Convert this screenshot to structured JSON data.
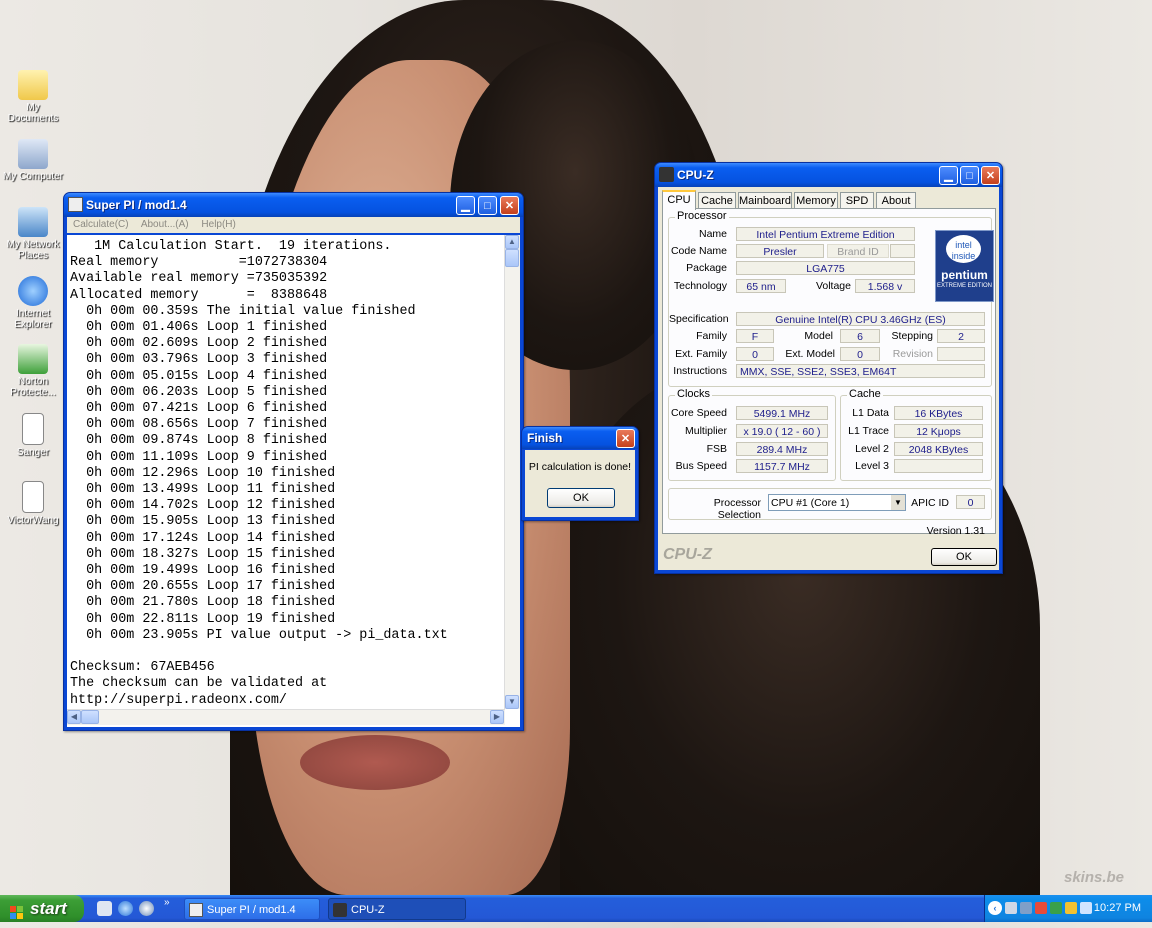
{
  "desktop": {
    "icons": [
      {
        "label": "My Documents",
        "icon": "folder-icon"
      },
      {
        "label": "My Computer",
        "icon": "computer-icon"
      },
      {
        "label": "My Network Places",
        "icon": "network-icon"
      },
      {
        "label": "Internet Explorer",
        "icon": "ie-icon"
      },
      {
        "label": "Norton Protecte...",
        "icon": "norton-icon"
      },
      {
        "label": "Sanger",
        "icon": "text-file-icon"
      },
      {
        "label": "VictorWang",
        "icon": "text-file-icon"
      }
    ],
    "watermark": "skins.be"
  },
  "superpi": {
    "title": "Super PI / mod1.4",
    "menu": [
      "Calculate(C)",
      "About...(A)",
      "Help(H)"
    ],
    "output": "   1M Calculation Start.  19 iterations.\nReal memory          =1072738304\nAvailable real memory =735035392\nAllocated memory      =  8388648\n  0h 00m 00.359s The initial value finished\n  0h 00m 01.406s Loop 1 finished\n  0h 00m 02.609s Loop 2 finished\n  0h 00m 03.796s Loop 3 finished\n  0h 00m 05.015s Loop 4 finished\n  0h 00m 06.203s Loop 5 finished\n  0h 00m 07.421s Loop 6 finished\n  0h 00m 08.656s Loop 7 finished\n  0h 00m 09.874s Loop 8 finished\n  0h 00m 11.109s Loop 9 finished\n  0h 00m 12.296s Loop 10 finished\n  0h 00m 13.499s Loop 11 finished\n  0h 00m 14.702s Loop 12 finished\n  0h 00m 15.905s Loop 13 finished\n  0h 00m 17.124s Loop 14 finished\n  0h 00m 18.327s Loop 15 finished\n  0h 00m 19.499s Loop 16 finished\n  0h 00m 20.655s Loop 17 finished\n  0h 00m 21.780s Loop 18 finished\n  0h 00m 22.811s Loop 19 finished\n  0h 00m 23.905s PI value output -> pi_data.txt\n\nChecksum: 67AEB456\nThe checksum can be validated at\nhttp://superpi.radeonx.com/"
  },
  "finish_dialog": {
    "title": "Finish",
    "message": "PI calculation is done!",
    "ok": "OK"
  },
  "cpuz": {
    "title": "CPU-Z",
    "tabs": [
      "CPU",
      "Cache",
      "Mainboard",
      "Memory",
      "SPD",
      "About"
    ],
    "active_tab": "CPU",
    "processor": {
      "group": "Processor",
      "name_label": "Name",
      "name": "Intel Pentium Extreme Edition",
      "codename_label": "Code Name",
      "codename": "Presler",
      "brandid_label": "Brand ID",
      "brandid": "",
      "package_label": "Package",
      "package": "LGA775",
      "technology_label": "Technology",
      "technology": "65 nm",
      "voltage_label": "Voltage",
      "voltage": "1.568 v",
      "spec_label": "Specification",
      "spec": "Genuine Intel(R) CPU 3.46GHz (ES)",
      "family_label": "Family",
      "family": "F",
      "model_label": "Model",
      "model": "6",
      "stepping_label": "Stepping",
      "stepping": "2",
      "extfamily_label": "Ext. Family",
      "extfamily": "0",
      "extmodel_label": "Ext. Model",
      "extmodel": "0",
      "revision_label": "Revision",
      "revision": "",
      "instructions_label": "Instructions",
      "instructions": "MMX, SSE, SSE2, SSE3, EM64T",
      "logo_top": "intel inside",
      "logo_brand": "pentium",
      "logo_sub": "EXTREME EDITION"
    },
    "clocks": {
      "group": "Clocks",
      "corespeed_label": "Core Speed",
      "corespeed": "5499.1 MHz",
      "multiplier_label": "Multiplier",
      "multiplier": "x 19.0  ( 12 - 60 )",
      "fsb_label": "FSB",
      "fsb": "289.4 MHz",
      "busspeed_label": "Bus Speed",
      "busspeed": "1157.7 MHz"
    },
    "cache": {
      "group": "Cache",
      "l1data_label": "L1 Data",
      "l1data": "16 KBytes",
      "l1trace_label": "L1 Trace",
      "l1trace": "12 Kμops",
      "level2_label": "Level 2",
      "level2": "2048 KBytes",
      "level3_label": "Level 3",
      "level3": ""
    },
    "selection_label": "Processor Selection",
    "selection": "CPU #1 (Core 1)",
    "apic_label": "APIC ID",
    "apic": "0",
    "version": "Version 1.31",
    "brand": "CPU-Z",
    "ok": "OK"
  },
  "taskbar": {
    "start": "start",
    "tasks": [
      "Super PI / mod1.4",
      "CPU-Z"
    ],
    "clock": "10:27 PM"
  }
}
